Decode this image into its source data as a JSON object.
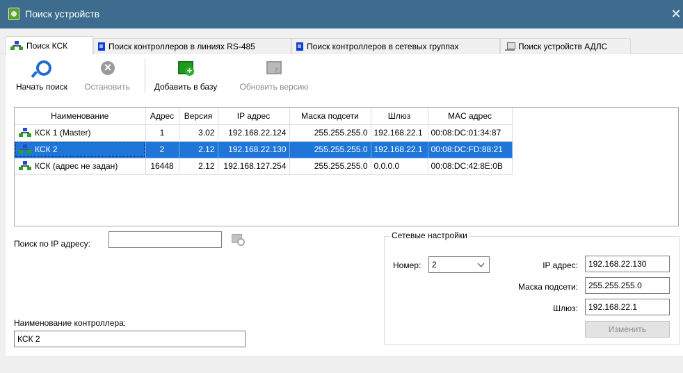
{
  "window": {
    "title": "Поиск устройств"
  },
  "tabs": [
    {
      "label": "Поиск КСК"
    },
    {
      "label": "Поиск контроллеров в линиях RS-485"
    },
    {
      "label": "Поиск контроллеров в сетевых группах"
    },
    {
      "label": "Поиск устройств АДЛС"
    }
  ],
  "toolbar": {
    "start_search": "Начать поиск",
    "stop": "Остановить",
    "add_to_db": "Добавить в базу",
    "update_version": "Обновить версию"
  },
  "devices": {
    "columns": [
      "Наименование",
      "Адрес",
      "Версия",
      "IP адрес",
      "Маска подсети",
      "Шлюз",
      "MAC адрес"
    ],
    "rows": [
      {
        "name": "КСК 1 (Master)",
        "address": "1",
        "version": "3.02",
        "ip": "192.168.22.124",
        "mask": "255.255.255.0",
        "gateway": "192.168.22.1",
        "mac": "00:08:DC:01:34:87"
      },
      {
        "name": "КСК 2",
        "address": "2",
        "version": "2.12",
        "ip": "192.168.22.130",
        "mask": "255.255.255.0",
        "gateway": "192.168.22.1",
        "mac": "00:08:DC:FD:88:21"
      },
      {
        "name": "КСК (адрес не задан)",
        "address": "16448",
        "version": "2.12",
        "ip": "192.168.127.254",
        "mask": "255.255.255.0",
        "gateway": "0.0.0.0",
        "mac": "00:08:DC:42:8E:0B"
      }
    ],
    "selected_row": 2
  },
  "ip_search": {
    "label": "Поиск по IP адресу:",
    "value": ""
  },
  "controller_name": {
    "label": "Наименование контроллера:",
    "value": "КСК 2"
  },
  "network": {
    "title": "Сетевые настройки",
    "number_label": "Номер:",
    "number_value": "2",
    "ip_label": "IP адрес:",
    "ip_value": "192.168.22.130",
    "mask_label": "Маска подсети:",
    "mask_value": "255.255.255.0",
    "gateway_label": "Шлюз:",
    "gateway_value": "192.168.22.1",
    "change_button": "Изменить"
  }
}
